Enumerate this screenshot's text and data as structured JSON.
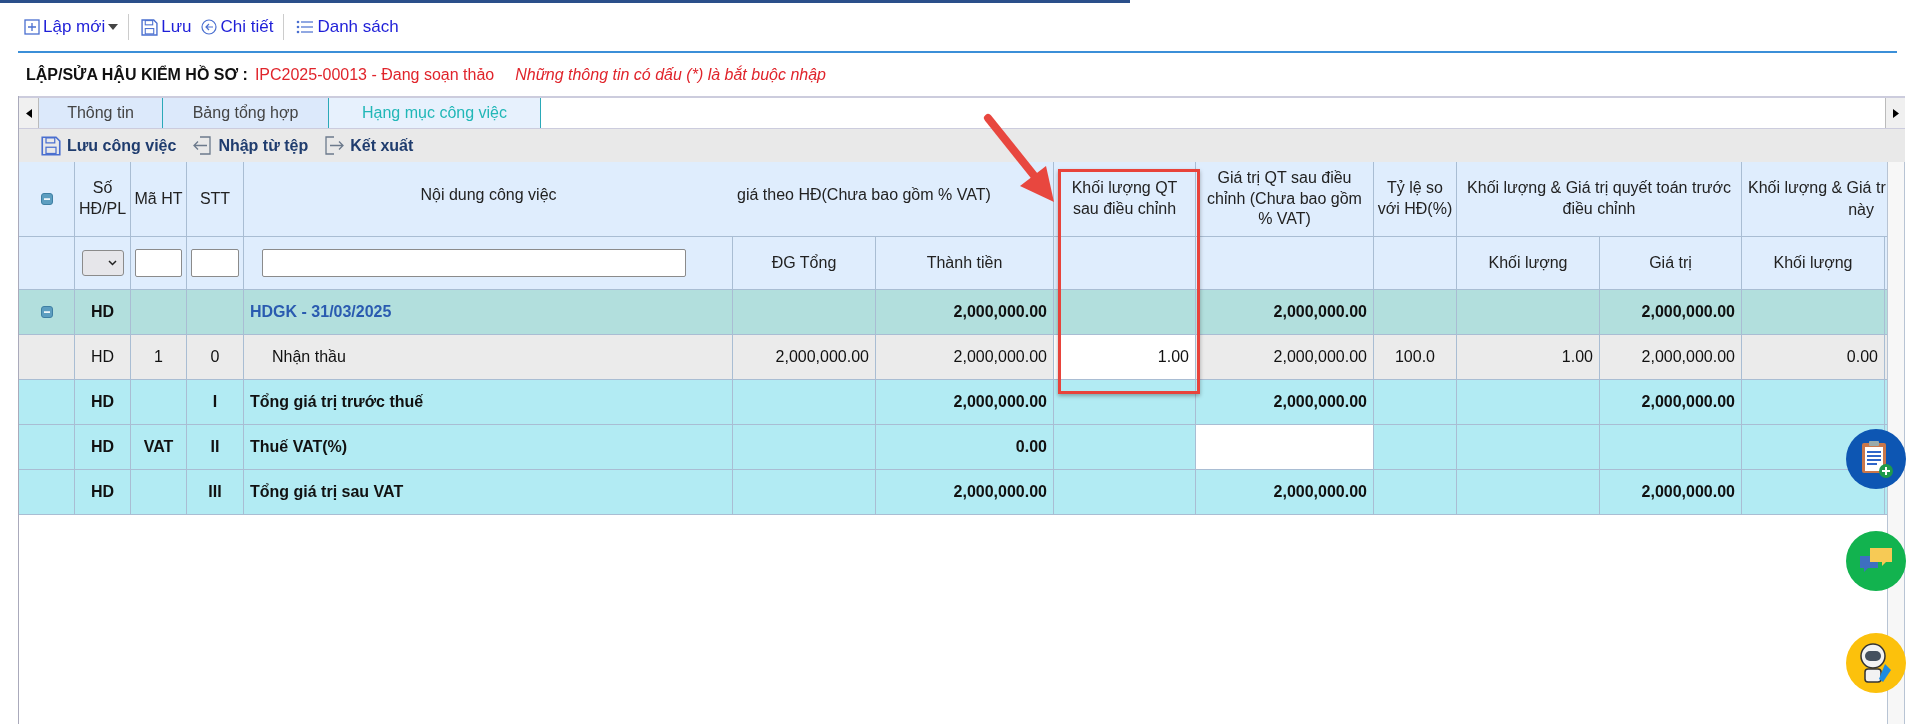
{
  "toolbar": [
    {
      "kind": "new",
      "label": "Lập mới",
      "dropdown": true,
      "separator": false
    },
    {
      "kind": "save",
      "label": "Lưu",
      "dropdown": false,
      "separator": true
    },
    {
      "kind": "detail",
      "label": "Chi tiết",
      "dropdown": false,
      "separator": false
    },
    {
      "kind": "list",
      "label": "Danh sách",
      "dropdown": false,
      "separator": true
    }
  ],
  "heading": {
    "title": "LẬP/SỬA HẬU KIỂM HỒ SƠ :",
    "record": "IPC2025-00013 - Đang soạn thảo",
    "note": "Những thông tin có dấu (*) là bắt buộc nhập"
  },
  "tabs": [
    {
      "label": "Thông tin",
      "selected": false
    },
    {
      "label": "Bảng tổng hợp",
      "selected": false
    },
    {
      "label": "Hạng mục công việc",
      "selected": true
    }
  ],
  "actions": [
    {
      "kind": "save",
      "label": "Lưu công việc"
    },
    {
      "kind": "import",
      "label": "Nhập từ tệp"
    },
    {
      "kind": "export",
      "label": "Kết xuất"
    }
  ],
  "table": {
    "header_row_1": [
      {
        "kind": "toggle",
        "expanded": true
      },
      {
        "kind": "text",
        "text": "Số HĐ/PL"
      },
      {
        "kind": "text",
        "text": "Mã HT"
      },
      {
        "kind": "text",
        "text": "STT"
      },
      {
        "kind": "text",
        "text": "Nội dung công việc"
      },
      {
        "kind": "clipped",
        "text": "giá theo HĐ(Chưa bao gồm % VAT)"
      },
      {
        "kind": "text",
        "text": "Khối lượng QT sau điều chỉnh"
      },
      {
        "kind": "text",
        "text": "Giá trị QT sau điều chỉnh (Chưa bao gồm % VAT)"
      },
      {
        "kind": "text",
        "text": "Tỷ lệ so với HĐ(%)"
      },
      {
        "kind": "text",
        "text": "Khối lượng & Giá trị quyết toán trước điều chỉnh"
      },
      {
        "kind": "lines",
        "lines": [
          "Khối lượng & Giá tr",
          "này"
        ]
      }
    ],
    "header_row_2": [
      {
        "kind": "blank"
      },
      {
        "kind": "select"
      },
      {
        "kind": "input"
      },
      {
        "kind": "input"
      },
      {
        "kind": "input"
      },
      "ĐG Tổng",
      "Thành tiền",
      {
        "kind": "blank"
      },
      {
        "kind": "blank"
      },
      {
        "kind": "blank"
      },
      "Khối lượng",
      "Giá trị",
      "Khối lượng",
      {
        "kind": "blank"
      }
    ],
    "rows": [
      {
        "kind": "group",
        "expanded": true,
        "cells": [
          "",
          "HD",
          "",
          "",
          "HDGK - 31/03/2025",
          "",
          "2,000,000.00",
          "",
          "2,000,000.00",
          "",
          "",
          "2,000,000.00",
          "",
          ""
        ]
      },
      {
        "kind": "item",
        "cells": [
          "",
          "HD",
          "1",
          "0",
          "Nhận thầu",
          "2,000,000.00",
          "2,000,000.00",
          {
            "kind": "input",
            "value": "1.00"
          },
          "2,000,000.00",
          "100.0",
          "1.00",
          "2,000,000.00",
          "0.00",
          ""
        ]
      },
      {
        "kind": "total",
        "cells": [
          "",
          "HD",
          "",
          "I",
          "Tổng giá trị trước thuế",
          "",
          "2,000,000.00",
          "",
          "2,000,000.00",
          "",
          "",
          "2,000,000.00",
          "",
          ""
        ]
      },
      {
        "kind": "total",
        "cells": [
          "",
          "HD",
          "VAT",
          "II",
          "Thuế VAT(%)",
          "",
          "0.00",
          "",
          {
            "kind": "input"
          },
          "",
          "",
          "",
          "",
          ""
        ]
      },
      {
        "kind": "total",
        "cells": [
          "",
          "HD",
          "",
          "III",
          "Tổng giá trị sau VAT",
          "",
          "2,000,000.00",
          "",
          "2,000,000.00",
          "",
          "",
          "2,000,000.00",
          "",
          ""
        ]
      }
    ]
  },
  "annotations": {
    "highlight_box": true,
    "arrow": true
  },
  "floating_buttons": [
    {
      "kind": "clipboard"
    },
    {
      "kind": "chat"
    },
    {
      "kind": "robot"
    }
  ]
}
